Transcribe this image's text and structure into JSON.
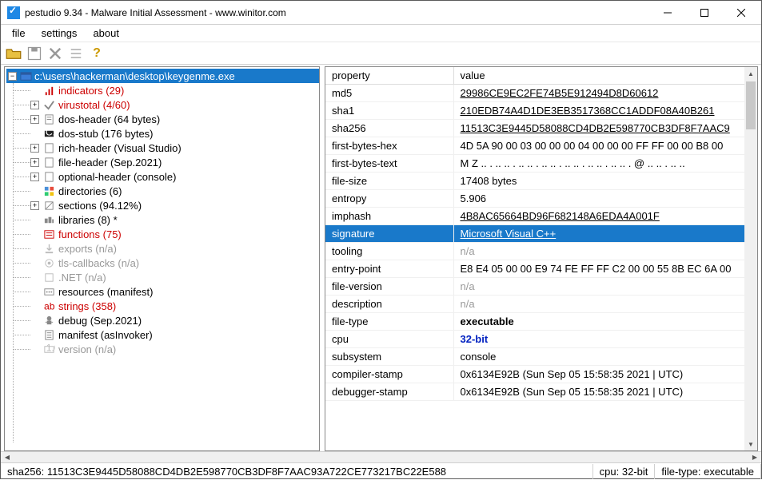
{
  "title": "pestudio 9.34 - Malware Initial Assessment - www.winitor.com",
  "menu": {
    "file": "file",
    "settings": "settings",
    "about": "about"
  },
  "columns": {
    "prop": "property",
    "val": "value"
  },
  "tree": {
    "root": "c:\\users\\hackerman\\desktop\\keygenme.exe",
    "items": [
      {
        "label": "indicators (29)",
        "cls": "red"
      },
      {
        "label": "virustotal (4/60)",
        "cls": "red"
      },
      {
        "label": "dos-header (64 bytes)",
        "cls": ""
      },
      {
        "label": "dos-stub (176 bytes)",
        "cls": ""
      },
      {
        "label": "rich-header (Visual Studio)",
        "cls": ""
      },
      {
        "label": "file-header (Sep.2021)",
        "cls": ""
      },
      {
        "label": "optional-header (console)",
        "cls": ""
      },
      {
        "label": "directories (6)",
        "cls": ""
      },
      {
        "label": "sections (94.12%)",
        "cls": ""
      },
      {
        "label": "libraries (8) *",
        "cls": ""
      },
      {
        "label": "functions (75)",
        "cls": "red"
      },
      {
        "label": "exports (n/a)",
        "cls": "grey"
      },
      {
        "label": "tls-callbacks (n/a)",
        "cls": "grey"
      },
      {
        "label": ".NET (n/a)",
        "cls": "grey"
      },
      {
        "label": "resources (manifest)",
        "cls": ""
      },
      {
        "label": "strings (358)",
        "cls": "red"
      },
      {
        "label": "debug (Sep.2021)",
        "cls": ""
      },
      {
        "label": "manifest (asInvoker)",
        "cls": ""
      },
      {
        "label": "version (n/a)",
        "cls": "grey"
      }
    ]
  },
  "rows": [
    {
      "p": "md5",
      "v": "29986CE9EC2FE74B5E912494D8D60612",
      "u": true
    },
    {
      "p": "sha1",
      "v": "210EDB74A4D1DE3EB3517368CC1ADDF08A40B261",
      "u": true
    },
    {
      "p": "sha256",
      "v": "11513C3E9445D58088CD4DB2E598770CB3DF8F7AAC9",
      "u": true
    },
    {
      "p": "first-bytes-hex",
      "v": "4D 5A 90 00 03 00 00 00 04 00 00 00 FF FF 00 00 B8 00 "
    },
    {
      "p": "first-bytes-text",
      "v": "M Z .. . .. .. . .. .. . .. .. . .. .. . .. .. . .. .. . @ .. .. . .. .."
    },
    {
      "p": "file-size",
      "v": "17408 bytes"
    },
    {
      "p": "entropy",
      "v": "5.906"
    },
    {
      "p": "imphash",
      "v": "4B8AC65664BD96F682148A6EDA4A001F",
      "u": true
    },
    {
      "p": "signature",
      "v": "Microsoft Visual C++",
      "sel": true,
      "u": true
    },
    {
      "p": "tooling",
      "v": "n/a",
      "na": true
    },
    {
      "p": "entry-point",
      "v": "E8 E4 05 00 00 E9 74 FE FF FF C2 00 00 55 8B EC 6A 00 "
    },
    {
      "p": "file-version",
      "v": "n/a",
      "na": true
    },
    {
      "p": "description",
      "v": "n/a",
      "na": true
    },
    {
      "p": "file-type",
      "v": "executable",
      "bold": true
    },
    {
      "p": "cpu",
      "v": "32-bit",
      "blue": true,
      "bold": true
    },
    {
      "p": "subsystem",
      "v": "console"
    },
    {
      "p": "compiler-stamp",
      "v": "0x6134E92B (Sun Sep 05 15:58:35 2021 | UTC)"
    },
    {
      "p": "debugger-stamp",
      "v": "0x6134E92B (Sun Sep 05 15:58:35 2021 | UTC)"
    }
  ],
  "status": {
    "sha256": "sha256: 11513C3E9445D58088CD4DB2E598770CB3DF8F7AAC93A722CE773217BC22E588",
    "cpu": "cpu: 32-bit",
    "filetype": "file-type: executable"
  }
}
